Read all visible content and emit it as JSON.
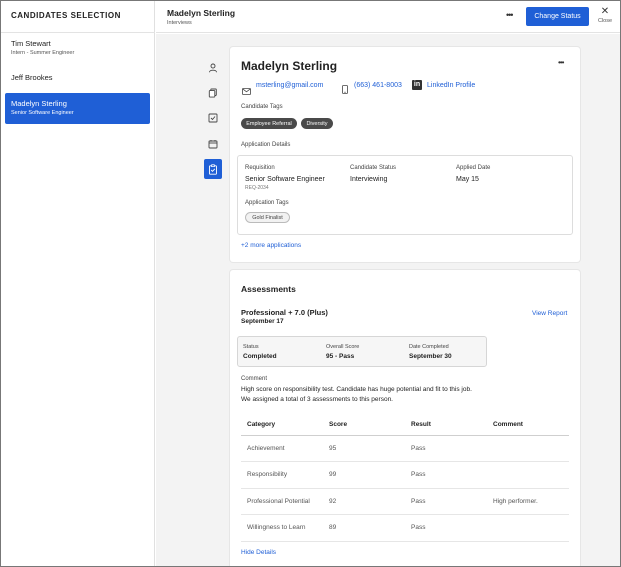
{
  "sidebar": {
    "title": "CANDIDATES SELECTION",
    "items": [
      {
        "name": "Tim Stewart",
        "subtitle": "Intern - Summer Engineer"
      },
      {
        "name": "Jeff Brookes",
        "subtitle": ""
      },
      {
        "name": "Madelyn Sterling",
        "subtitle": "Senior Software Engineer"
      }
    ]
  },
  "header": {
    "name": "Madelyn Sterling",
    "subtitle": "Interviews",
    "more": "•••",
    "change_status": "Change Status",
    "close_label": "Close",
    "close_glyph": "✕"
  },
  "profile": {
    "name": "Madelyn Sterling",
    "more": "•••",
    "email": "msterling@gmail.com",
    "phone": "(663) 461-8003",
    "linkedin_badge": "in",
    "linkedin": "LinkedIn Profile",
    "candidate_tags_label": "Candidate Tags",
    "candidate_tags": [
      "Employee Referral",
      "Diversity"
    ],
    "application_details_label": "Application Details",
    "requisition_label": "Requisition",
    "requisition_value": "Senior Software Engineer",
    "requisition_id": "REQ-2034",
    "candidate_status_label": "Candidate Status",
    "candidate_status_value": "Interviewing",
    "applied_date_label": "Applied Date",
    "applied_date_value": "May 15",
    "application_tags_label": "Application Tags",
    "application_tags": [
      "Gold Finalist"
    ],
    "more_applications": "+2 more applications"
  },
  "assessments": {
    "title": "Assessments",
    "assessment_name": "Professional + 7.0 (Plus)",
    "assessment_date": "September 17",
    "view_report": "View Report",
    "status_label": "Status",
    "status_value": "Completed",
    "score_label": "Overall Score",
    "score_value": "95 - Pass",
    "date_completed_label": "Date Completed",
    "date_completed_value": "September 30",
    "comment_label": "Comment",
    "comment_line1": "High score on responsibility test. Candidate has huge potential and fit to this job.",
    "comment_line2": "We assigned a total of 3 assessments to this person.",
    "columns": [
      "Category",
      "Score",
      "Result",
      "Comment"
    ],
    "rows": [
      [
        "Achievement",
        "95",
        "Pass",
        ""
      ],
      [
        "Responsibility",
        "99",
        "Pass",
        ""
      ],
      [
        "Professional Potential",
        "92",
        "Pass",
        "High performer."
      ],
      [
        "Willingness to Learn",
        "89",
        "Pass",
        ""
      ]
    ],
    "hide_details": "Hide Details"
  },
  "colors": {
    "accent": "#1f5fd6",
    "tag_dark": "#4a4a4a",
    "background": "#f3f3f3"
  },
  "rail_icons": [
    "person-icon",
    "documents-icon",
    "checklist-icon",
    "calendar-icon",
    "clipboard-check-icon"
  ]
}
